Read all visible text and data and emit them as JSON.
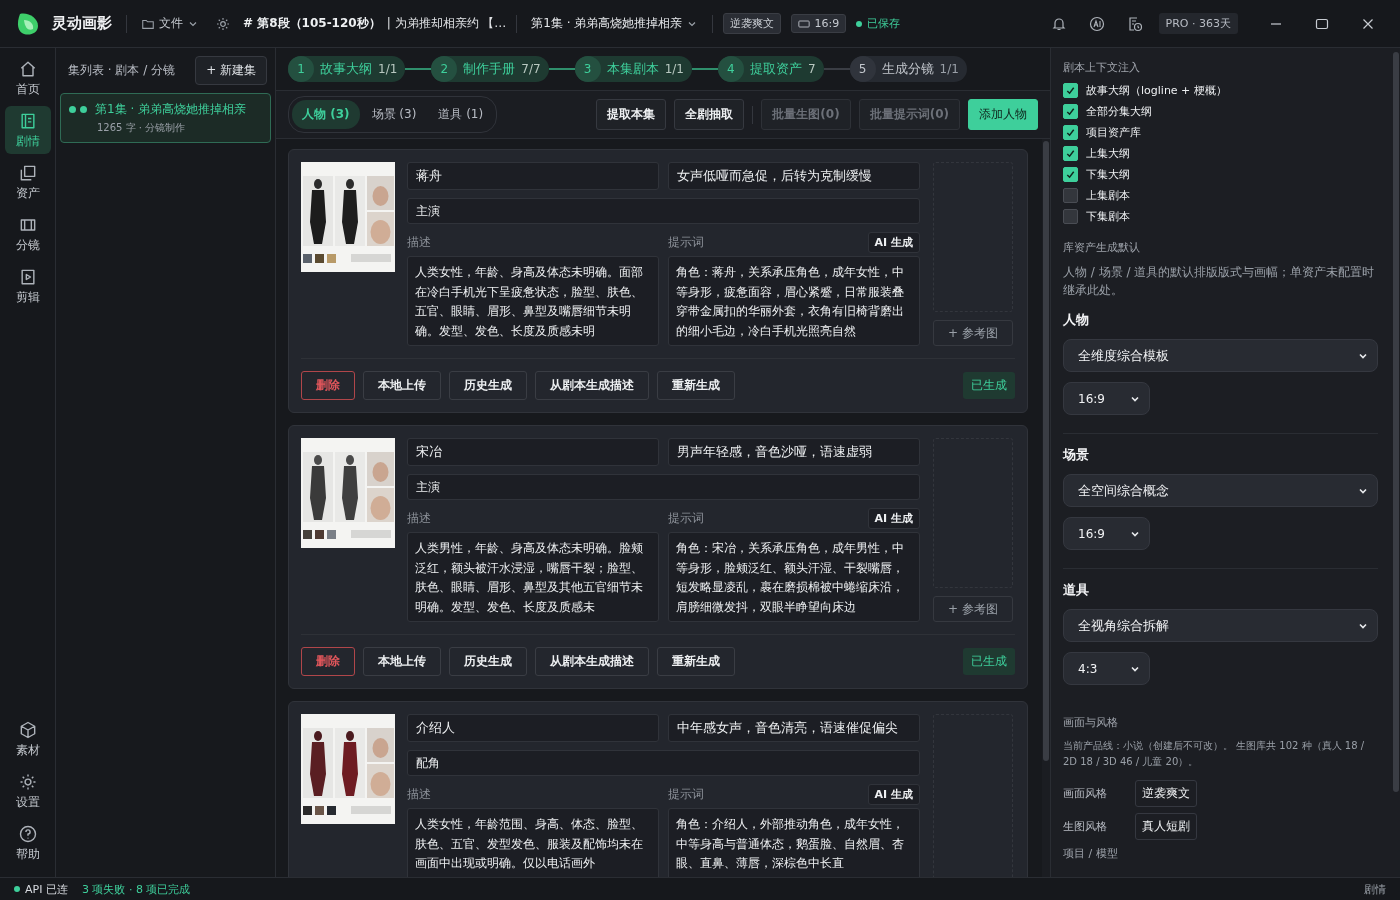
{
  "app": {
    "name": "灵动画影"
  },
  "topbar": {
    "file_menu": "文件",
    "segment": "# 第8段（105-120秒）",
    "segment_title": "| 为弟推却相亲约 【…",
    "episode": "第1集 · 弟弟高烧她推掉相亲",
    "genre": "逆袭爽文",
    "ratio": "16:9",
    "save_status": "已保存",
    "plan": "PRO · 363天"
  },
  "nav": {
    "items": [
      {
        "label": "首页",
        "selected": false
      },
      {
        "label": "剧情",
        "selected": true
      },
      {
        "label": "资产",
        "selected": false
      },
      {
        "label": "分镜",
        "selected": false
      },
      {
        "label": "剪辑",
        "selected": false
      }
    ],
    "bottom_items": [
      {
        "label": "素材",
        "selected": false
      },
      {
        "label": "设置",
        "selected": false
      },
      {
        "label": "帮助",
        "selected": false
      }
    ]
  },
  "episodes": {
    "header": "集列表 · 剧本 / 分镜",
    "new_button": "+ 新建集",
    "items": [
      {
        "title": "第1集 · 弟弟高烧她推掉相亲",
        "meta": "1265 字 · 分镜制作",
        "selected": true
      }
    ]
  },
  "pipeline": [
    {
      "number": "1",
      "label": "故事大纲",
      "count": "1/1",
      "completed": true,
      "current": false
    },
    {
      "number": "2",
      "label": "制作手册",
      "count": "7/7",
      "completed": true,
      "current": false
    },
    {
      "number": "3",
      "label": "本集剧本",
      "count": "1/1",
      "completed": true,
      "current": false
    },
    {
      "number": "4",
      "label": "提取资产",
      "count": "7",
      "completed": true,
      "current": true
    },
    {
      "number": "5",
      "label": "生成分镜",
      "count": "1/1",
      "completed": false,
      "current": false
    }
  ],
  "asset_tabs": [
    {
      "label": "人物 (3)",
      "selected": true
    },
    {
      "label": "场景 (3)",
      "selected": false
    },
    {
      "label": "道具 (1)",
      "selected": false
    }
  ],
  "actions": [
    {
      "label": "提取本集",
      "kind": "normal"
    },
    {
      "label": "全剧抽取",
      "kind": "normal"
    },
    {
      "label": "批量生图(0)",
      "kind": "disabled"
    },
    {
      "label": "批量提示词(0)",
      "kind": "disabled"
    },
    {
      "label": "添加人物",
      "kind": "primary"
    }
  ],
  "characters": [
    {
      "name": "蒋舟",
      "voice": "女声低哑而急促，后转为克制缓慢",
      "role": "主演",
      "description_label": "描述",
      "prompt_label": "提示词",
      "ai_button": "AI 生成",
      "description": "人类女性，年龄、身高及体态未明确。面部在冷白手机光下呈疲惫状态，脸型、肤色、五官、眼睛、眉形、鼻型及嘴唇细节未明确。发型、发色、长度及质感未明",
      "prompt": "角色：蒋舟，关系承压角色，成年女性，中等身形，疲惫面容，眉心紧蹙，日常服装叠穿带金属扣的华丽外套，衣角有旧椅背磨出的细小毛边，冷白手机光照亮自然",
      "ref_button": "+ 参考图",
      "buttons": [
        "删除",
        "本地上传",
        "历史生成",
        "从剧本生成描述",
        "重新生成"
      ],
      "status": "已生成"
    },
    {
      "name": "宋冶",
      "voice": "男声年轻感，音色沙哑，语速虚弱",
      "role": "主演",
      "description_label": "描述",
      "prompt_label": "提示词",
      "ai_button": "AI 生成",
      "description": "人类男性，年龄、身高及体态未明确。脸颊泛红，额头被汗水浸湿，嘴唇干裂；脸型、肤色、眼睛、眉形、鼻型及其他五官细节未明确。发型、发色、长度及质感未",
      "prompt": "角色：宋冶，关系承压角色，成年男性，中等身形，脸颊泛红、额头汗湿、干裂嘴唇，短发略显凌乱，裹在磨损棉被中蜷缩床沿，肩膀细微发抖，双眼半睁望向床边",
      "ref_button": "+ 参考图",
      "buttons": [
        "删除",
        "本地上传",
        "历史生成",
        "从剧本生成描述",
        "重新生成"
      ],
      "status": "已生成"
    },
    {
      "name": "介绍人",
      "voice": "中年感女声，音色清亮，语速催促偏尖",
      "role": "配角",
      "description_label": "描述",
      "prompt_label": "提示词",
      "ai_button": "AI 生成",
      "description": "人类女性，年龄范围、身高、体态、脸型、肤色、五官、发型发色、服装及配饰均未在画面中出现或明确。仅以电话画外",
      "prompt": "角色：介绍人，外部推动角色，成年女性，中等身高与普通体态，鹅蛋脸、自然眉、杏眼、直鼻、薄唇，深棕色中长直"
    }
  ],
  "context": {
    "title": "剧本上下文注入",
    "options": [
      {
        "label": "故事大纲（logline + 梗概）",
        "checked": true
      },
      {
        "label": "全部分集大纲",
        "checked": true
      },
      {
        "label": "项目资产库",
        "checked": true
      },
      {
        "label": "上集大纲",
        "checked": true
      },
      {
        "label": "下集大纲",
        "checked": true
      },
      {
        "label": "上集剧本",
        "checked": false
      },
      {
        "label": "下集剧本",
        "checked": false
      }
    ]
  },
  "defaults": {
    "title": "库资产生成默认",
    "note": "人物 / 场景 / 道具的默认排版版式与画幅；单资产未配置时继承此处。",
    "groups": [
      {
        "label": "人物",
        "template": "全维度综合模板",
        "ratio": "16:9"
      },
      {
        "label": "场景",
        "template": "全空间综合概念",
        "ratio": "16:9"
      },
      {
        "label": "道具",
        "template": "全视角综合拆解",
        "ratio": "4:3"
      }
    ]
  },
  "style": {
    "title": "画面与风格",
    "note": "当前产品线：小说（创建后不可改）。 生图库共 102 种（真人 18 / 2D 18 / 3D 46 / 儿童 20）。",
    "fields": [
      {
        "label": "画面风格",
        "value": "逆袭爽文"
      },
      {
        "label": "生图风格",
        "value": "真人短剧"
      }
    ],
    "next_title": "项目 / 模型"
  },
  "status_bar": {
    "api": "API 已连",
    "jobs": "3 项失败 · 8 项已完成",
    "page": "剧情"
  }
}
